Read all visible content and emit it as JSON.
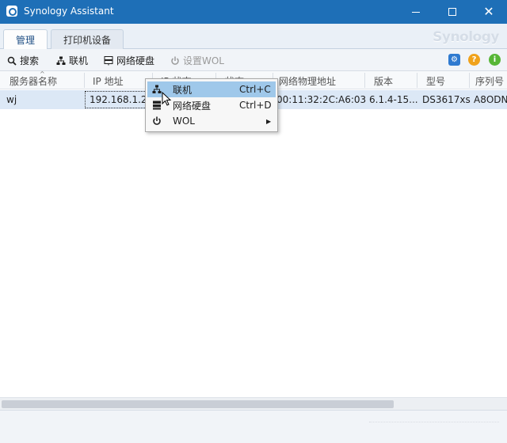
{
  "window": {
    "title": "Synology Assistant",
    "close_glyph": "✕"
  },
  "tabs": [
    {
      "label": "管理",
      "active": true
    },
    {
      "label": "打印机设备",
      "active": false
    }
  ],
  "brand": "Synology",
  "toolbar": {
    "search": "搜索",
    "connect": "联机",
    "map_drive": "网络硬盘",
    "set_wol": "设置WOL",
    "icons": {
      "settings": "gear-icon",
      "help": "help-icon",
      "info": "info-icon"
    }
  },
  "table": {
    "columns": [
      "服务器名称",
      "IP 地址",
      "IP 状态",
      "状态",
      "网络物理地址",
      "版本",
      "型号",
      "序列号"
    ],
    "rows": [
      {
        "name": "wj",
        "ip": "192.168.1.23",
        "mac": "00:11:32:2C:A6:03",
        "version": "6.1.4-15...",
        "model": "DS3617xs",
        "serial": "A8ODN"
      }
    ]
  },
  "context_menu": [
    {
      "label": "联机",
      "shortcut": "Ctrl+C",
      "icon": "network-icon",
      "highlighted": true
    },
    {
      "label": "网络硬盘",
      "shortcut": "Ctrl+D",
      "icon": "drive-icon",
      "highlighted": false
    },
    {
      "label": "WOL",
      "shortcut": "",
      "icon": "power-icon",
      "has_submenu": true
    }
  ],
  "colors": {
    "titlebar": "#1e6fb7",
    "row_selected": "#dce8f6",
    "menu_highlight": "#9fc8ea"
  }
}
